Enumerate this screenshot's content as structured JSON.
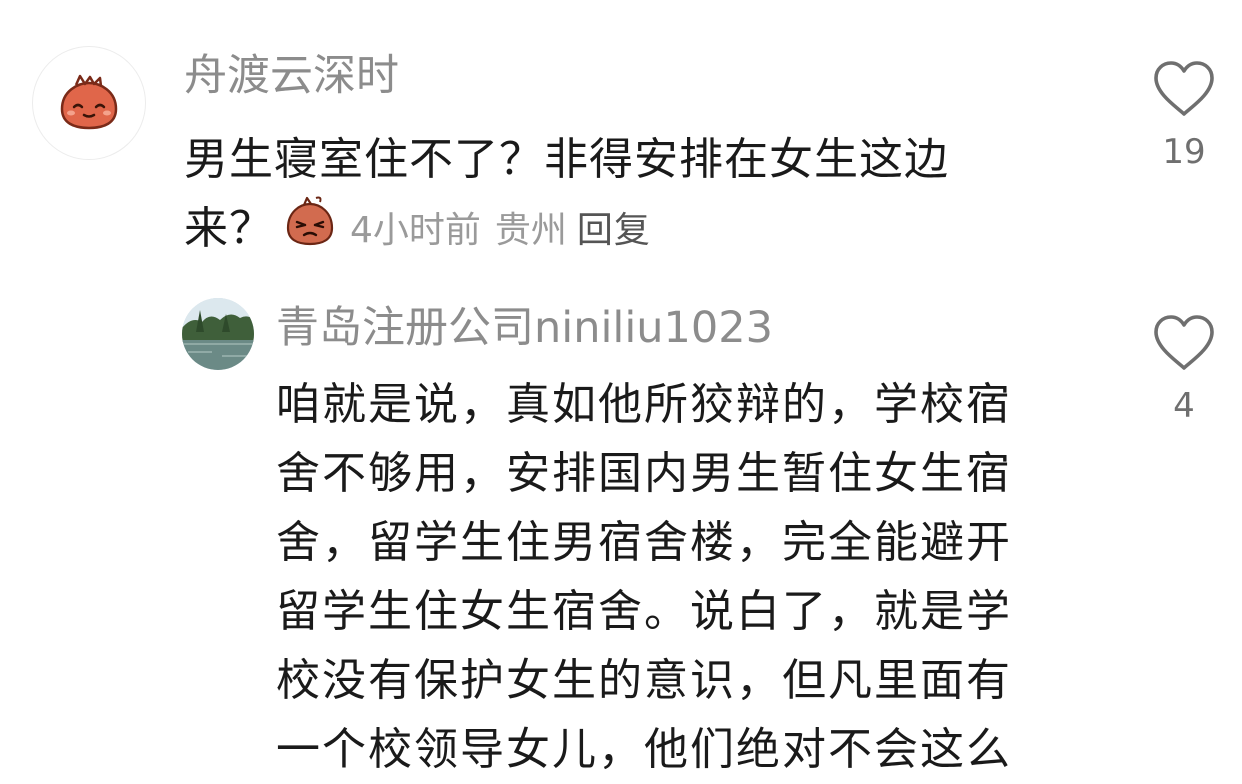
{
  "comments": [
    {
      "username": "舟渡云深时",
      "avatar_icon": "red-bean-bun-avatar-icon",
      "text_lines": [
        "男生寝室住不了？非得安排在女生这边",
        "来？"
      ],
      "emoji_icon": "frustrated-bun-emoji-icon",
      "time": "4小时前",
      "location": "贵州",
      "reply_label": "回复",
      "likes": "19"
    },
    {
      "username": "青岛注册公司niniliu1023",
      "avatar_icon": "lake-landscape-avatar-icon",
      "text_lines": [
        "咱就是说，真如他所狡辩的，学校宿",
        "舍不够用，安排国内男生暂住女生宿",
        "舍，留学生住男宿舍楼，完全能避开",
        "留学生住女生宿舍。说白了，就是学",
        "校没有保护女生的意识，但凡里面有",
        "一个校领导女儿，他们绝对不会这么"
      ],
      "likes": "4"
    }
  ],
  "icons": {
    "like": "heart-outline-icon"
  },
  "colors": {
    "username": "#8c8c8c",
    "body_text": "#1a1a1a",
    "meta": "#9a9a9a",
    "avatar_bun": "#e0664a"
  }
}
